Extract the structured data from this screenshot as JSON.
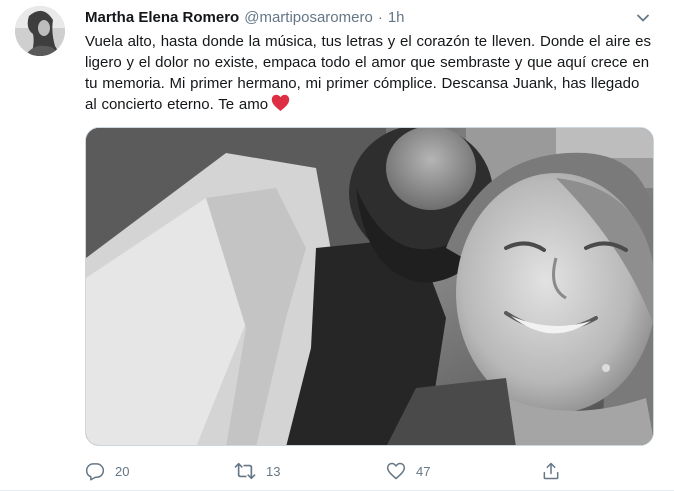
{
  "tweet": {
    "author_name": "Martha Elena Romero",
    "handle": "@martiposaromero",
    "separator": "·",
    "time": "1h",
    "text_body": "Vuela alto, hasta donde la música, tus letras y el corazón te lleven. Donde el aire es ligero y el dolor no existe, empaca todo el amor que sembraste y que aquí crece en tu memoria. Mi primer hermano, mi primer cómplice. Descansa Juank, has llegado al concierto eterno. Te amo",
    "emoji": "red-heart",
    "avatar_icon": "profile-photo",
    "media_icon": "black-and-white-photo"
  },
  "actions": {
    "reply_count": "20",
    "retweet_count": "13",
    "like_count": "47",
    "share_icon": "share-icon"
  },
  "colors": {
    "text": "#14171a",
    "secondary": "#657786",
    "heart": "#dd2e44",
    "border": "#e6ecf0"
  }
}
